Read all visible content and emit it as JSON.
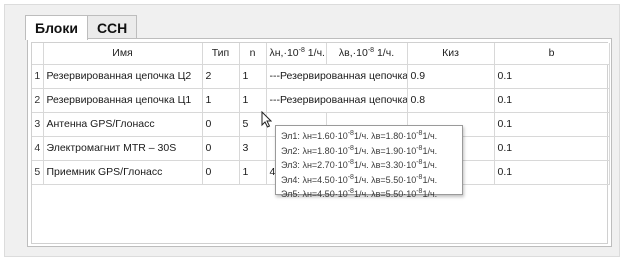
{
  "tabs": [
    {
      "label": "Блоки",
      "active": true
    },
    {
      "label": "ССН",
      "active": false
    }
  ],
  "table": {
    "columns": {
      "name": "Имя",
      "type": "Тип",
      "n": "n",
      "lambda_n_prefix": "λн,·10",
      "lambda_n_exp": "-8",
      "lambda_n_suffix": " 1/ч.",
      "lambda_v_prefix": "λв,·10",
      "lambda_v_exp": "-8",
      "lambda_v_suffix": " 1/ч.",
      "kiz": "Киз",
      "b": "b"
    },
    "rows": [
      {
        "num": "1",
        "name": "Резервированная цепочка Ц2",
        "type": "2",
        "n": "1",
        "lambda_span": "---Резервированная цепочка---",
        "kiz": "0.9",
        "b": "0.1"
      },
      {
        "num": "2",
        "name": "Резервированная цепочка Ц1",
        "type": "1",
        "n": "1",
        "lambda_span": "---Резервированная цепочка---",
        "kiz": "0.8",
        "b": "0.1"
      },
      {
        "num": "3",
        "name": "Антенна GPS/Глонасс",
        "type": "0",
        "n": "5",
        "lambda_n": "",
        "lambda_v": "",
        "kiz": "",
        "b": "0.1"
      },
      {
        "num": "4",
        "name": "Электромагнит MTR – 30S",
        "type": "0",
        "n": "3",
        "lambda_n": "",
        "lambda_v": "",
        "kiz": "",
        "b": "0.1"
      },
      {
        "num": "5",
        "name": "Приемник GPS/Глонасс",
        "type": "0",
        "n": "1",
        "lambda_n": "4",
        "lambda_v": "",
        "kiz": "",
        "b": "0.1"
      }
    ]
  },
  "tooltip": {
    "lines": [
      {
        "el": "Эл1:",
        "ln": "λн=1.60·10",
        "lv": "1/ч.  λв=1.80·10",
        "end": "1/ч."
      },
      {
        "el": "Эл2:",
        "ln": "λн=1.80·10",
        "lv": "1/ч.  λв=1.90·10",
        "end": "1/ч."
      },
      {
        "el": "Эл3:",
        "ln": "λн=2.70·10",
        "lv": "1/ч.  λв=3.30·10",
        "end": "1/ч."
      },
      {
        "el": "Эл4:",
        "ln": "λн=4.50·10",
        "lv": "1/ч.  λв=5.50·10",
        "end": "1/ч."
      },
      {
        "el": "Эл5:",
        "ln": "λн=4.50·10",
        "lv": "1/ч.  λв=5.50·10",
        "end": "1/ч."
      }
    ],
    "exp": "-8"
  },
  "cursor_icon": "mouse-pointer-icon"
}
